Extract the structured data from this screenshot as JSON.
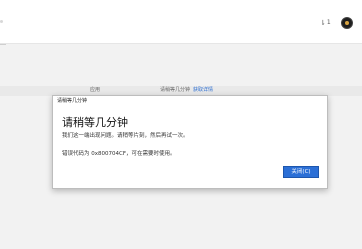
{
  "header": {
    "notification_count": "1",
    "notification_icon": "user-indicator-icon"
  },
  "band": {
    "col1": "应用",
    "col2": "请稍等几分钟",
    "col2_link": "获取详情"
  },
  "dialog": {
    "title": "请稍等几分钟",
    "heading": "请稍等几分钟",
    "message": "我们这一端出现问题。请稍等片刻，然后再试一次。",
    "error_line": "错误代码为 0x800704CF，可在需要时使用。",
    "close_label": "关闭(C)"
  },
  "colors": {
    "accent": "#2b6fd6",
    "link": "#2e6fd1"
  }
}
